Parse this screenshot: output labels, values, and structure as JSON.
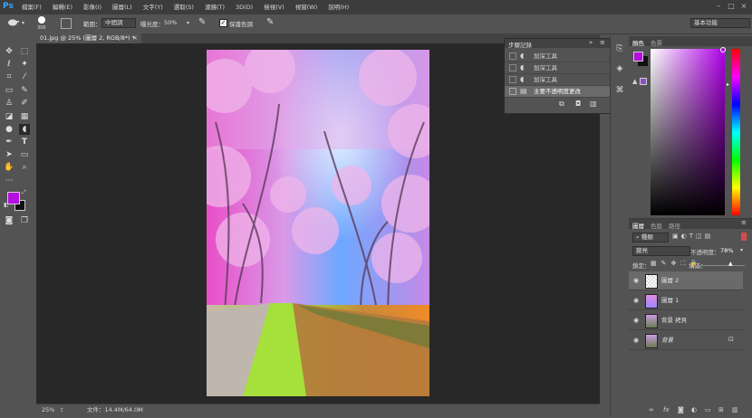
{
  "app": {
    "logo": "Ps"
  },
  "menu": [
    "檔案(F)",
    "編輯(E)",
    "影像(I)",
    "圖層(L)",
    "文字(Y)",
    "選取(S)",
    "濾鏡(T)",
    "3D(D)",
    "檢視(V)",
    "視窗(W)",
    "說明(H)"
  ],
  "options": {
    "brush_size": "306",
    "range_label": "範圍：",
    "range_value": "中間調",
    "exposure_label": "曝光度：",
    "exposure_value": "50%",
    "protect_label": "保護色調",
    "workspace": "基本功能"
  },
  "document": {
    "tab": "01.jpg @ 25% (圖層 2, RGB/8*) *",
    "zoom": "25%",
    "doc_info": "文件：14.4M/64.0M"
  },
  "history": {
    "tab": "步驟記錄",
    "items": [
      "加深工具",
      "加深工具",
      "加深工具",
      "主要不透明度更改"
    ]
  },
  "color": {
    "tabs": [
      "顏色",
      "色票"
    ],
    "foreground": "#b40fe0",
    "background": "#111111"
  },
  "layers": {
    "tabs": [
      "圖層",
      "色版",
      "路徑"
    ],
    "filter": "種類",
    "blend": "變亮",
    "opacity_label": "不透明度：",
    "opacity_value": "78%",
    "lock_label": "鎖定：",
    "fill_label": "填滿：",
    "fill_value": "",
    "items": [
      {
        "name": "圖層 2",
        "selected": true
      },
      {
        "name": "圖層 1",
        "selected": false
      },
      {
        "name": "背景 拷貝",
        "selected": false
      },
      {
        "name": "背景",
        "selected": false,
        "italic": true
      }
    ]
  }
}
